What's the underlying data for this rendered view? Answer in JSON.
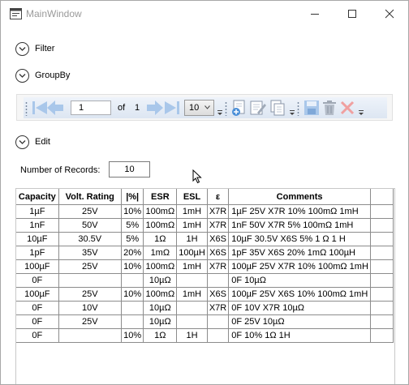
{
  "window": {
    "title": "MainWindow"
  },
  "expanders": {
    "filter": "Filter",
    "groupby": "GroupBy",
    "edit": "Edit"
  },
  "pager": {
    "current_page": "1",
    "of_label": "of",
    "total_pages": "1",
    "page_size": "10"
  },
  "records": {
    "label": "Number of Records:",
    "value": "10"
  },
  "table": {
    "columns": [
      "Capacity",
      "Volt. Rating",
      "|%|",
      "ESR",
      "ESL",
      "ε",
      "Comments"
    ],
    "rows": [
      [
        "1µF",
        "25V",
        "10%",
        "100mΩ",
        "1mH",
        "X7R",
        "1µF 25V X7R 10% 100mΩ 1mH"
      ],
      [
        "1nF",
        "50V",
        "5%",
        "100mΩ",
        "1mH",
        "X7R",
        "1nF 50V X7R 5% 100mΩ 1mH"
      ],
      [
        "10µF",
        "30.5V",
        "5%",
        "1Ω",
        "1H",
        "X6S",
        "10µF 30.5V X6S 5% 1 Ω 1 H"
      ],
      [
        "1pF",
        "35V",
        "20%",
        "1mΩ",
        "100µH",
        "X6S",
        "1pF 35V X6S 20% 1mΩ 100µH"
      ],
      [
        "100µF",
        "25V",
        "10%",
        "100mΩ",
        "1mH",
        "X7R",
        "100µF 25V X7R 10% 100mΩ 1mH"
      ],
      [
        "0F",
        "",
        "",
        "10µΩ",
        "",
        "",
        "0F 10µΩ"
      ],
      [
        "100µF",
        "25V",
        "10%",
        "100mΩ",
        "1mH",
        "X6S",
        "100µF 25V X6S 10% 100mΩ 1mH"
      ],
      [
        "0F",
        "10V",
        "",
        "10µΩ",
        "",
        "X7R",
        "0F 10V X7R 10µΩ"
      ],
      [
        "0F",
        "25V",
        "",
        "10µΩ",
        "",
        "",
        "0F 25V 10µΩ"
      ],
      [
        "0F",
        "",
        "10%",
        "1Ω",
        "1H",
        "",
        "0F 10% 1Ω 1H"
      ]
    ]
  }
}
